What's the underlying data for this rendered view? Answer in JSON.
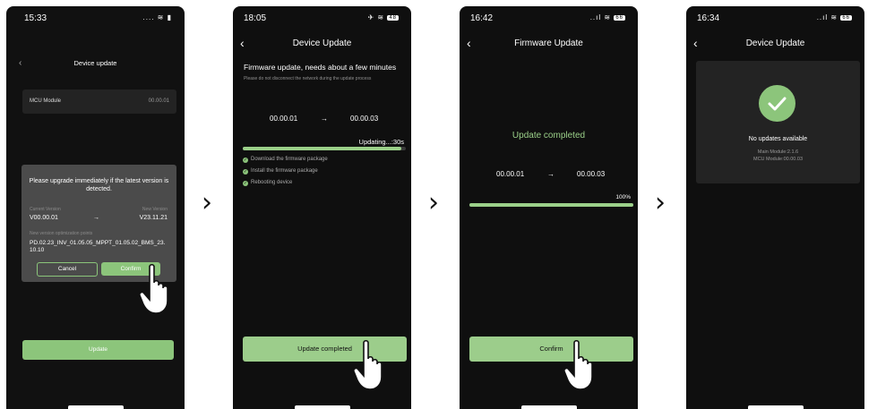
{
  "colors": {
    "accent": "#8cc57b",
    "background": "#0f0f0f"
  },
  "screen1": {
    "status": {
      "time": "15:33",
      "icons": "....  ≋  ▮"
    },
    "nav": {
      "title": "Device update",
      "back_icon": "chevron-left-icon"
    },
    "mcu": {
      "label": "MCU Module",
      "version": "00.00.01"
    },
    "dialog": {
      "title": "Please upgrade immediately if the latest version is detected.",
      "current_label": "Current Version",
      "current_value": "V00.00.01",
      "arrow": "→",
      "new_label": "New Version",
      "new_value": "V23.11.21",
      "notes_label": "New version optimization points",
      "notes": "PD.02.23_INV_01.05.05_MPPT_01.05.02_BMS_23.10.10",
      "cancel": "Cancel",
      "confirm": "Confirm"
    },
    "update_button": "Update"
  },
  "screen2": {
    "status": {
      "time": "18:05",
      "icons": "✈ ≋",
      "battery": "48"
    },
    "nav": {
      "title": "Device Update"
    },
    "heading": "Firmware update, needs about a few minutes",
    "subtext": "Please do not disconnect the network during the update process",
    "from": "00.00.01",
    "arrow": "→",
    "to": "00.00.03",
    "progress_text": "Updating...:30s",
    "progress": 0.97,
    "steps": [
      "Download the firmware package",
      "Install the firmware package",
      "Rebooting device"
    ],
    "button": "Update completed"
  },
  "screen3": {
    "status": {
      "time": "16:42",
      "icons": "..ıl ≋",
      "battery": "66"
    },
    "nav": {
      "title": "Firmware Update"
    },
    "heading": "Update completed",
    "from": "00.00.01",
    "arrow": "→",
    "to": "00.00.03",
    "percent": "100%",
    "progress": 1.0,
    "button": "Confirm"
  },
  "screen4": {
    "status": {
      "time": "16:34",
      "icons": "..ıl ≋",
      "battery": "66"
    },
    "nav": {
      "title": "Device Update"
    },
    "status_text": "No updates available",
    "main_module": "Main Module:2.1.6",
    "mcu_module": "MCU Module:00.00.03"
  },
  "separators": [
    "›",
    "›",
    "›"
  ]
}
